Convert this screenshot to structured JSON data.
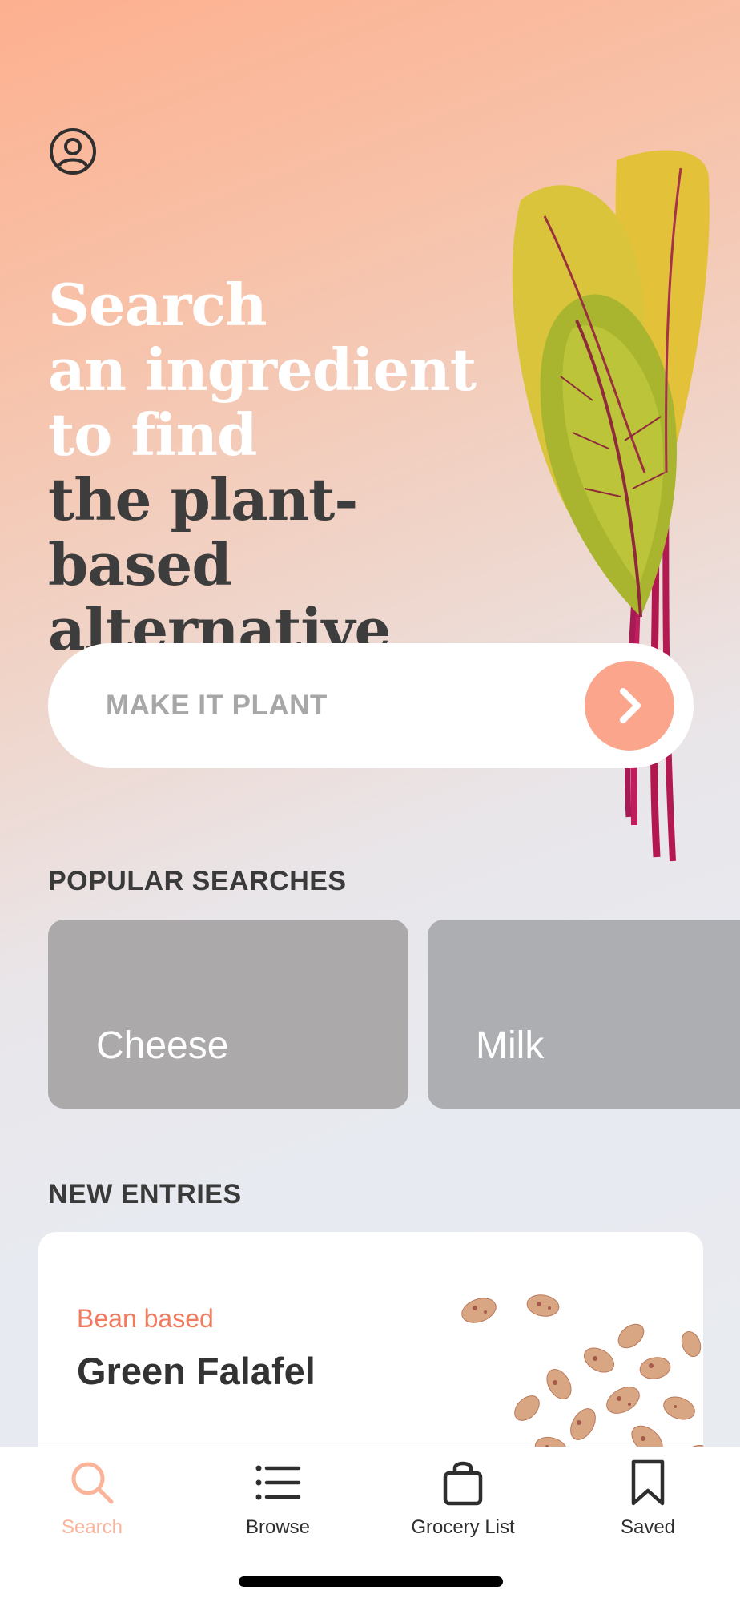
{
  "hero": {
    "line1": "Search",
    "line2": "an ingredient",
    "line3": "to find",
    "line4": "the plant-based",
    "line5": "alternative"
  },
  "search": {
    "placeholder": "MAKE IT PLANT",
    "go_icon": "chevron-right-icon"
  },
  "profile_icon": "user-circle-icon",
  "popular": {
    "title": "POPULAR SEARCHES",
    "items": [
      {
        "label": "Cheese"
      },
      {
        "label": "Milk"
      }
    ]
  },
  "new_entries": {
    "title": "NEW ENTRIES",
    "items": [
      {
        "category": "Bean based",
        "name": "Green Falafel"
      }
    ]
  },
  "tabbar": {
    "tabs": [
      {
        "label": "Search",
        "icon": "search-icon",
        "active": true
      },
      {
        "label": "Browse",
        "icon": "list-icon",
        "active": false
      },
      {
        "label": "Grocery List",
        "icon": "shopping-bag-icon",
        "active": false
      },
      {
        "label": "Saved",
        "icon": "bookmark-icon",
        "active": false
      }
    ]
  },
  "colors": {
    "accent": "#fba68c",
    "category": "#f27a5e",
    "active_tab": "#fbb49a",
    "text_dark": "#3a3a3a"
  }
}
